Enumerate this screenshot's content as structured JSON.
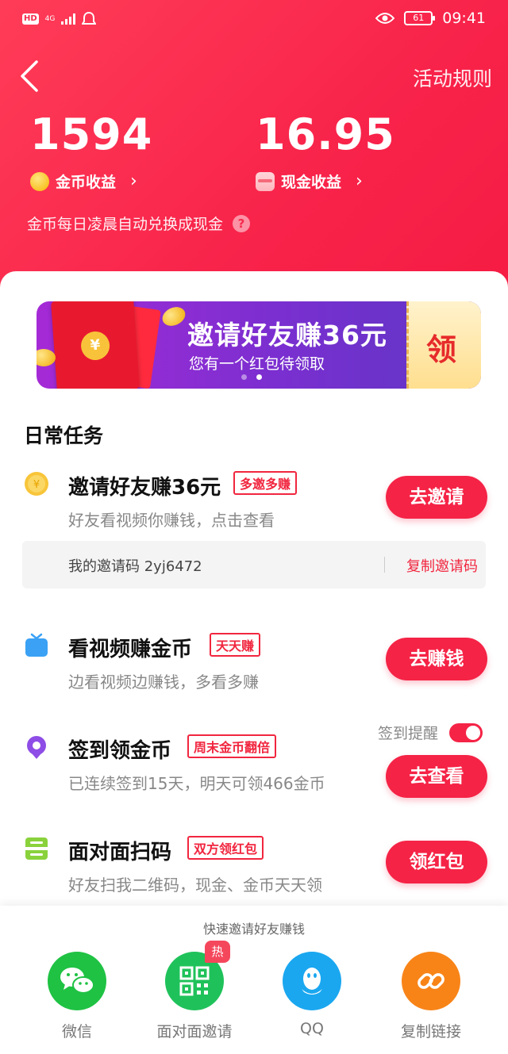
{
  "status_bar": {
    "hd": "HD",
    "network": "4G",
    "battery": "61",
    "time": "09:41"
  },
  "header": {
    "rules": "活动规则",
    "coins": {
      "value": "1594",
      "label": "金币收益"
    },
    "cash": {
      "value": "16.95",
      "label": "现金收益"
    },
    "note": "金币每日凌晨自动兑换成现金",
    "help": "?"
  },
  "banner": {
    "title": "邀请好友赚36元",
    "subtitle": "您有一个红包待领取",
    "ticket": "领",
    "coin_symbol": "¥"
  },
  "section_title": "日常任务",
  "tasks": [
    {
      "title": "邀请好友赚36元",
      "tag": "多邀多赚",
      "desc": "好友看视频你赚钱，点击查看",
      "button": "去邀请",
      "icon": "coin-icon"
    },
    {
      "title": "看视频赚金币",
      "tag": "天天赚",
      "desc": "边看视频边赚钱，多看多赚",
      "button": "去赚钱",
      "icon": "tv-icon"
    },
    {
      "title": "签到领金币",
      "tag": "周末金币翻倍",
      "desc": "已连续签到15天，明天可领466金币",
      "button": "去查看",
      "icon": "location-pin-icon"
    },
    {
      "title": "面对面扫码",
      "tag": "双方领红包",
      "desc": "好友扫我二维码，现金、金币天天领",
      "button": "领红包",
      "icon": "scan-icon"
    }
  ],
  "invite_code": {
    "text": "我的邀请码 2yj6472",
    "copy": "复制邀请码"
  },
  "sign_in_reminder": {
    "label": "签到提醒",
    "on": true
  },
  "share": {
    "title": "快速邀请好友赚钱",
    "items": [
      {
        "label": "微信",
        "icon": "wechat-icon",
        "color": "#1fc243"
      },
      {
        "label": "面对面邀请",
        "icon": "qr-code-icon",
        "color": "#1fc25a",
        "badge": "热"
      },
      {
        "label": "QQ",
        "icon": "qq-icon",
        "color": "#1aa7f0"
      },
      {
        "label": "复制链接",
        "icon": "link-icon",
        "color": "#f88418"
      }
    ]
  },
  "colors": {
    "brand_red": "#f52346",
    "header_gradient_start": "#ff3c58",
    "banner_purple": "#7a2fd0"
  }
}
